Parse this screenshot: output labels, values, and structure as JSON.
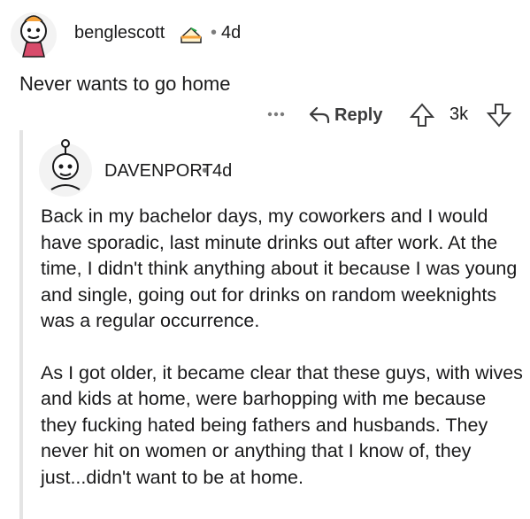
{
  "post": {
    "author": "benglescott",
    "dot": "•",
    "time": "4d",
    "text": "Never wants to go home",
    "actions": {
      "reply_label": "Reply",
      "score": "3k"
    }
  },
  "reply": {
    "author": "DAVENPORT",
    "dot": "•",
    "time": "4d",
    "paragraphs": [
      "Back in my bachelor days, my coworkers and I would have sporadic, last minute drinks out after work. At the time, I didn't think anything about it because I was young and single, going out for drinks on random weeknights was a regular occurrence.",
      "As I got older, it became clear that these guys, with wives and kids at home, were barhopping with me because they fucking hated being fathers and husbands. They never hit on women or anything that I know of, they just...didn't want to be at home."
    ]
  },
  "icons": {
    "avatar": "user-avatar-icon",
    "flair": "cake-flair-icon",
    "more": "more-options-icon",
    "reply": "reply-arrow-icon",
    "upvote": "upvote-arrow-icon",
    "downvote": "downvote-arrow-icon",
    "avatar2": "snoo-avatar-icon"
  },
  "colors": {
    "text": "#1a1a1b",
    "muted": "#7c7c7c",
    "thread_line": "#e4e4e4",
    "accent_orange": "#f6a23a"
  }
}
